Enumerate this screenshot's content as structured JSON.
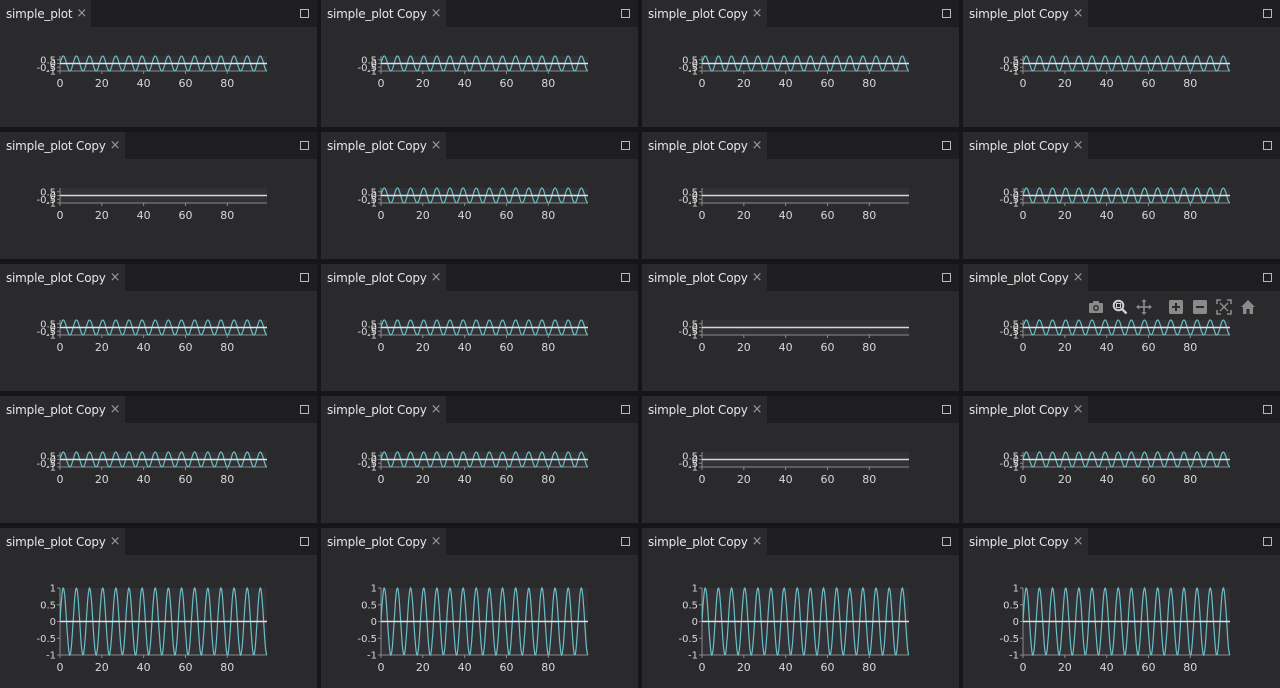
{
  "panels": [
    {
      "title": "simple_plot",
      "close": "×",
      "mode": "small"
    },
    {
      "title": "simple_plot Copy",
      "close": "×",
      "mode": "small"
    },
    {
      "title": "simple_plot Copy",
      "close": "×",
      "mode": "small"
    },
    {
      "title": "simple_plot Copy",
      "close": "×",
      "mode": "small"
    },
    {
      "title": "simple_plot Copy",
      "close": "×",
      "mode": "flat"
    },
    {
      "title": "simple_plot Copy",
      "close": "×",
      "mode": "small"
    },
    {
      "title": "simple_plot Copy",
      "close": "×",
      "mode": "flat"
    },
    {
      "title": "simple_plot Copy",
      "close": "×",
      "mode": "small"
    },
    {
      "title": "simple_plot Copy",
      "close": "×",
      "mode": "small"
    },
    {
      "title": "simple_plot Copy",
      "close": "×",
      "mode": "small"
    },
    {
      "title": "simple_plot Copy",
      "close": "×",
      "mode": "flat"
    },
    {
      "title": "simple_plot Copy",
      "close": "×",
      "mode": "small",
      "toolbar": true
    },
    {
      "title": "simple_plot Copy",
      "close": "×",
      "mode": "small"
    },
    {
      "title": "simple_plot Copy",
      "close": "×",
      "mode": "small"
    },
    {
      "title": "simple_plot Copy",
      "close": "×",
      "mode": "flat"
    },
    {
      "title": "simple_plot Copy",
      "close": "×",
      "mode": "small"
    },
    {
      "title": "simple_plot Copy",
      "close": "×",
      "mode": "full"
    },
    {
      "title": "simple_plot Copy",
      "close": "×",
      "mode": "full"
    },
    {
      "title": "simple_plot Copy",
      "close": "×",
      "mode": "full"
    },
    {
      "title": "simple_plot Copy",
      "close": "×",
      "mode": "full"
    }
  ],
  "toolbar_icons": [
    "camera-icon",
    "zoom-icon",
    "pan-icon",
    "zoom-in-icon",
    "zoom-out-icon",
    "autoscale-icon",
    "home-icon"
  ],
  "colors": {
    "sine": "#69bfc8",
    "zero_line": "#e2e2e2",
    "panel_bg": "#2a2a2d"
  },
  "chart_data": {
    "type": "line",
    "x_range": [
      0,
      99
    ],
    "xlim": [
      0,
      99
    ],
    "ylim": [
      -1,
      1
    ],
    "xticks": [
      "0",
      "20",
      "40",
      "60",
      "80"
    ],
    "yticks_small": [
      "0",
      "0.5",
      "-0.5",
      "-1"
    ],
    "yticks_full": [
      "1",
      "0.5",
      "0",
      "-0.5",
      "-1"
    ],
    "series": [
      {
        "values_formula": "sin(x * 1.0)",
        "cycles": 16
      },
      {
        "values_formula": "0"
      }
    ]
  }
}
